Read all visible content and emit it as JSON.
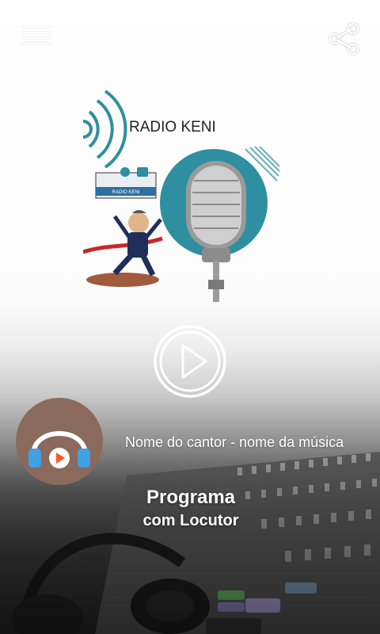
{
  "header": {
    "menu_icon": "hamburger-menu-icon",
    "share_icon": "share-icon"
  },
  "logo": {
    "text": "RADIO KENI",
    "sign_text": "RADIO KENI",
    "colors": {
      "teal": "#2d8fa0",
      "brown": "#a05a3c"
    }
  },
  "player": {
    "play_icon": "play-icon",
    "avatar_icon": "headphones-play-icon",
    "song_text": "Nome do cantor - nome da música"
  },
  "program": {
    "title": "Programa",
    "host": "com Locutor"
  }
}
